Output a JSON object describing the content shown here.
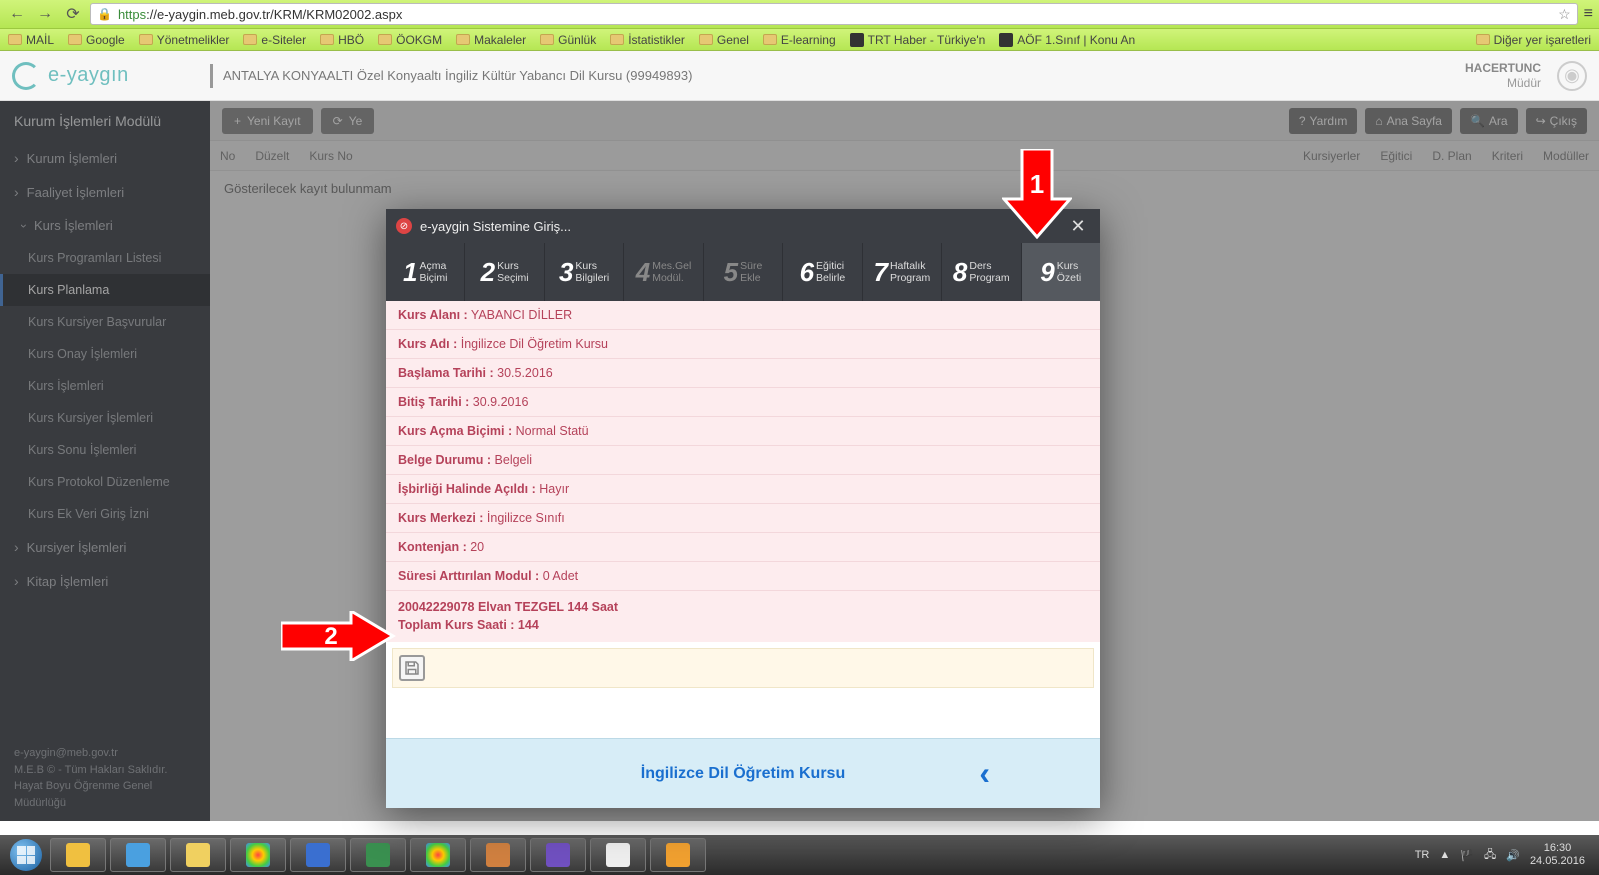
{
  "browser": {
    "url_prefix": "https",
    "url_rest": "://e-yaygin.meb.gov.tr/KRM/KRM02002.aspx",
    "bookmarks": [
      {
        "label": "MAİL",
        "type": "folder"
      },
      {
        "label": "Google",
        "type": "folder"
      },
      {
        "label": "Yönetmelikler",
        "type": "folder"
      },
      {
        "label": "e-Siteler",
        "type": "folder"
      },
      {
        "label": "HBÖ",
        "type": "folder"
      },
      {
        "label": "ÖOKGM",
        "type": "folder"
      },
      {
        "label": "Makaleler",
        "type": "folder"
      },
      {
        "label": "Günlük",
        "type": "folder"
      },
      {
        "label": "İstatistikler",
        "type": "folder"
      },
      {
        "label": "Genel",
        "type": "folder"
      },
      {
        "label": "E-learning",
        "type": "folder"
      },
      {
        "label": "TRT Haber - Türkiye'n",
        "type": "icon"
      },
      {
        "label": "AÖF 1.Sınıf | Konu An",
        "type": "icon"
      }
    ],
    "bookmarks_overflow": "Diğer yer işaretleri"
  },
  "header": {
    "logo_text": "e-yaygın",
    "title": "ANTALYA KONYAALTI Özel Konyaaltı İngiliz Kültür Yabancı Dil Kursu (99949893)",
    "user_name": "HACERTUNC",
    "user_role": "Müdür"
  },
  "sidebar": {
    "title": "Kurum İşlemleri Modülü",
    "items": [
      {
        "label": "Kurum İşlemleri",
        "expandable": true
      },
      {
        "label": "Faaliyet İşlemleri",
        "expandable": true
      },
      {
        "label": "Kurs İşlemleri",
        "expandable": true,
        "expanded": true,
        "children": [
          {
            "label": "Kurs Programları Listesi"
          },
          {
            "label": "Kurs Planlama",
            "active": true
          },
          {
            "label": "Kurs Kursiyer Başvurular"
          },
          {
            "label": "Kurs Onay İşlemleri"
          },
          {
            "label": "Kurs İşlemleri"
          },
          {
            "label": "Kurs Kursiyer İşlemleri"
          },
          {
            "label": "Kurs Sonu İşlemleri"
          },
          {
            "label": "Kurs Protokol Düzenleme"
          },
          {
            "label": "Kurs Ek Veri Giriş İzni"
          }
        ]
      },
      {
        "label": "Kursiyer İşlemleri",
        "expandable": true
      },
      {
        "label": "Kitap İşlemleri",
        "expandable": true
      }
    ],
    "footer_lines": [
      "e-yaygin@meb.gov.tr",
      "M.E.B © - Tüm Hakları Saklıdır.",
      "Hayat Boyu Öğrenme Genel Müdürlüğü"
    ]
  },
  "toolbar": {
    "new_label": "Yeni Kayıt",
    "refresh_label": "Ye",
    "help_label": "Yardım",
    "home_label": "Ana Sayfa",
    "search_label": "Ara",
    "exit_label": "Çıkış"
  },
  "grid": {
    "columns": [
      "No",
      "Düzelt",
      "Kurs No",
      "",
      "",
      "",
      "",
      "",
      "",
      "",
      "",
      "",
      "Kursiyerler",
      "Eğitici",
      "D. Plan",
      "Kriteri",
      "Modüller"
    ],
    "empty_text": "Gösterilecek kayıt bulunmam"
  },
  "modal": {
    "title": "e-yaygin Sistemine Giriş...",
    "steps": [
      {
        "n": "1",
        "l1": "Açma",
        "l2": "Biçimi"
      },
      {
        "n": "2",
        "l1": "Kurs",
        "l2": "Seçimi"
      },
      {
        "n": "3",
        "l1": "Kurs",
        "l2": "Bilgileri"
      },
      {
        "n": "4",
        "l1": "Mes.Gel",
        "l2": "Modül.",
        "inactive": true
      },
      {
        "n": "5",
        "l1": "Süre",
        "l2": "Ekle",
        "inactive": true
      },
      {
        "n": "6",
        "l1": "Eğitici",
        "l2": "Belirle"
      },
      {
        "n": "7",
        "l1": "Haftalık",
        "l2": "Program"
      },
      {
        "n": "8",
        "l1": "Ders",
        "l2": "Program"
      },
      {
        "n": "9",
        "l1": "Kurs",
        "l2": "Özeti",
        "active": true
      }
    ],
    "rows": [
      {
        "lbl": "Kurs Alanı :",
        "val": " YABANCI DİLLER"
      },
      {
        "lbl": "Kurs Adı :",
        "val": " İngilizce Dil Öğretim Kursu"
      },
      {
        "lbl": "Başlama Tarihi :",
        "val": " 30.5.2016"
      },
      {
        "lbl": "Bitiş Tarihi :",
        "val": " 30.9.2016"
      },
      {
        "lbl": "Kurs Açma Biçimi :",
        "val": " Normal Statü"
      },
      {
        "lbl": "Belge Durumu :",
        "val": " Belgeli"
      },
      {
        "lbl": "İşbirliği Halinde Açıldı :",
        "val": " Hayır"
      },
      {
        "lbl": "Kurs Merkezi :",
        "val": " İngilizce Sınıfı"
      },
      {
        "lbl": "Kontenjan :",
        "val": " 20"
      },
      {
        "lbl": "Süresi Arttırılan Modul :",
        "val": " 0 Adet"
      }
    ],
    "bottom_line1": "20042229078 Elvan TEZGEL 144 Saat",
    "bottom_line2": "Toplam Kurs Saati : 144",
    "footer_title": "İngilizce Dil Öğretim Kursu"
  },
  "arrows": {
    "a1": "1",
    "a2": "2"
  },
  "tray": {
    "lang": "TR",
    "time": "16:30",
    "date": "24.05.2016"
  }
}
